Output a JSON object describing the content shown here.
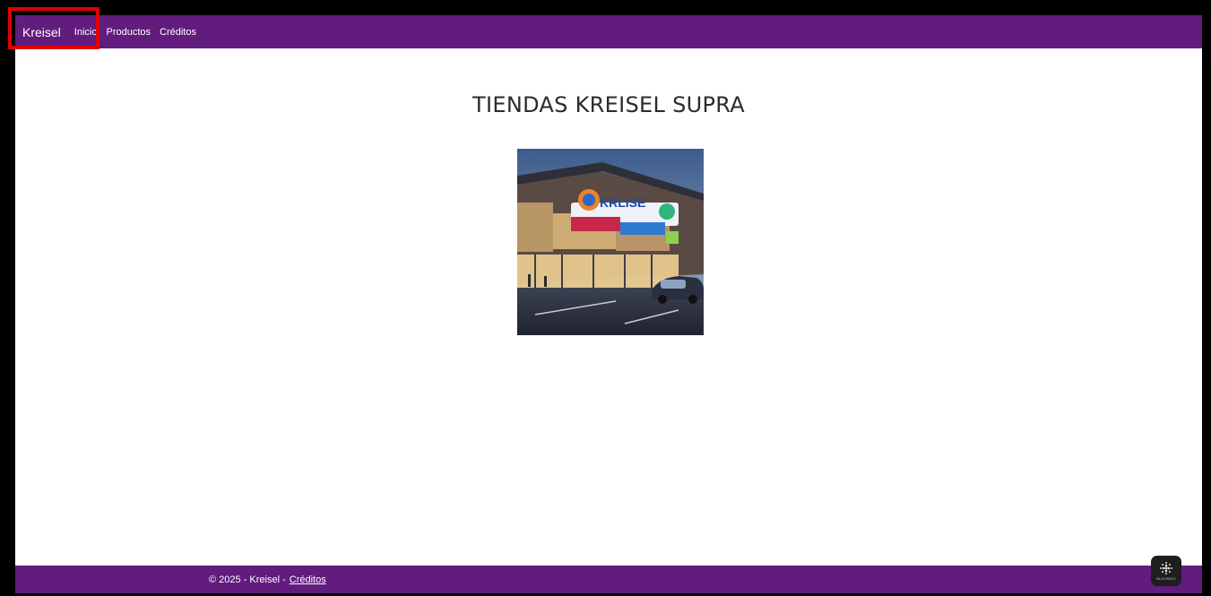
{
  "navbar": {
    "brand": "Kreisel",
    "links": [
      "Inicio",
      "Productos",
      "Créditos"
    ]
  },
  "main": {
    "title": "TIENDAS KREISEL SUPRA",
    "image": {
      "sign_text": "KRLISE"
    }
  },
  "footer": {
    "text": "© 2025 - Kreisel -",
    "link": "Créditos"
  },
  "widget": {
    "label": "BLACKBOX",
    "icon": "grid-dots-icon"
  },
  "colors": {
    "navbar_bg": "#611c7e",
    "highlight": "#e00000",
    "page_bg": "#ffffff"
  }
}
